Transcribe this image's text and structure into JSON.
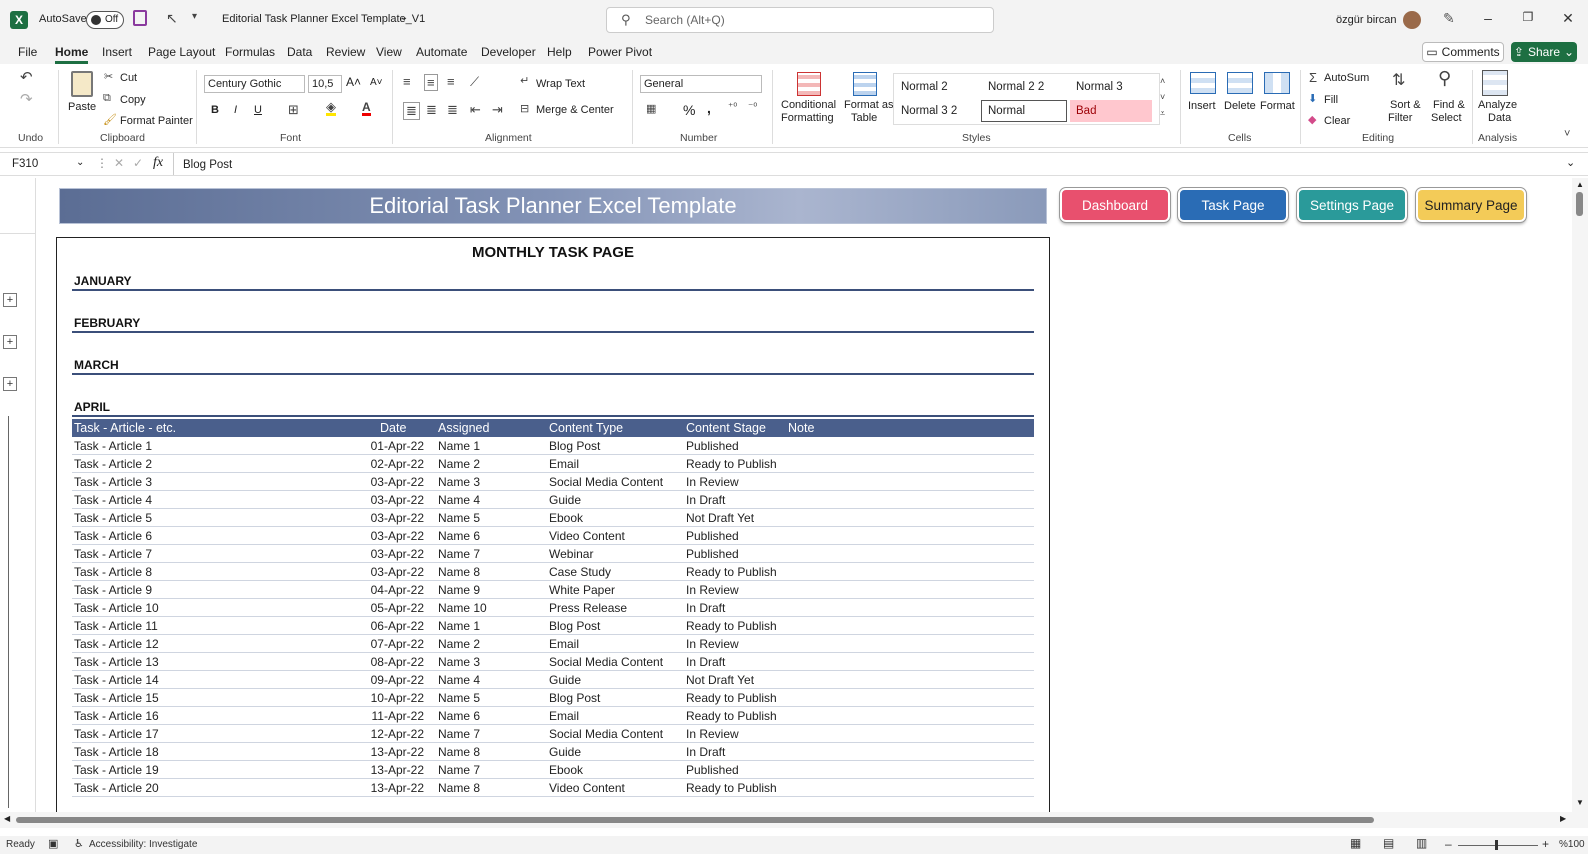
{
  "titlebar": {
    "app_logo": "X",
    "autosave_label": "AutoSave",
    "autosave_state": "Off",
    "doc_title": "Editorial Task Planner Excel Template_V1",
    "search_placeholder": "Search (Alt+Q)",
    "user_name": "özgür bircan"
  },
  "menu": [
    "File",
    "Home",
    "Insert",
    "Page Layout",
    "Formulas",
    "Data",
    "Review",
    "View",
    "Automate",
    "Developer",
    "Help",
    "Power Pivot"
  ],
  "menu_active": "Home",
  "buttons": {
    "comments": "Comments",
    "share": "Share"
  },
  "ribbon": {
    "undo_group": "Undo",
    "clipboard": {
      "paste": "Paste",
      "cut": "Cut",
      "copy": "Copy",
      "format_painter": "Format Painter",
      "label": "Clipboard"
    },
    "font": {
      "name": "Century Gothic",
      "size": "10,5",
      "label": "Font",
      "bold": "B",
      "italic": "I",
      "underline": "U"
    },
    "alignment": {
      "wrap": "Wrap Text",
      "merge": "Merge & Center",
      "label": "Alignment"
    },
    "number": {
      "format": "General",
      "label": "Number",
      "percent": "%",
      "comma": ","
    },
    "styles": {
      "cond1": "Conditional",
      "cond2": "Formatting",
      "fat1": "Format as",
      "fat2": "Table",
      "label": "Styles",
      "cells": [
        "Normal 2",
        "Normal 2 2",
        "Normal 3",
        "Normal 3 2",
        "Normal",
        "Bad"
      ]
    },
    "cells": {
      "insert": "Insert",
      "delete": "Delete",
      "format": "Format",
      "label": "Cells"
    },
    "editing": {
      "autosum": "AutoSum",
      "fill": "Fill",
      "clear": "Clear",
      "sort1": "Sort &",
      "sort2": "Filter",
      "find1": "Find &",
      "find2": "Select",
      "label": "Editing"
    },
    "analysis": {
      "a1": "Analyze",
      "a2": "Data",
      "label": "Analysis"
    }
  },
  "formula_bar": {
    "cell_ref": "F310",
    "fx": "fx",
    "value": "Blog Post"
  },
  "banner": "Editorial Task Planner Excel Template",
  "nav": {
    "dashboard": "Dashboard",
    "task": "Task Page",
    "settings": "Settings Page",
    "summary": "Summary Page"
  },
  "nav_colors": {
    "dashboard": "#e8506e",
    "task": "#2a6cb5",
    "settings": "#2a9a9a",
    "summary": "#f3cb58"
  },
  "panel_title": "MONTHLY TASK PAGE",
  "months": [
    "JANUARY",
    "FEBRUARY",
    "MARCH",
    "APRIL"
  ],
  "table": {
    "headers": [
      "Task - Article - etc.",
      "Date",
      "Assigned",
      "Content Type",
      "Content Stage",
      "Note"
    ],
    "rows": [
      [
        "Task - Article 1",
        "01-Apr-22",
        "Name 1",
        "Blog Post",
        "Published"
      ],
      [
        "Task - Article 2",
        "02-Apr-22",
        "Name 2",
        "Email",
        "Ready to Publish"
      ],
      [
        "Task - Article 3",
        "03-Apr-22",
        "Name 3",
        "Social Media Content",
        "In Review"
      ],
      [
        "Task - Article 4",
        "03-Apr-22",
        "Name 4",
        "Guide",
        "In Draft"
      ],
      [
        "Task - Article 5",
        "03-Apr-22",
        "Name 5",
        "Ebook",
        "Not Draft Yet"
      ],
      [
        "Task - Article 6",
        "03-Apr-22",
        "Name 6",
        "Video Content",
        "Published"
      ],
      [
        "Task - Article 7",
        "03-Apr-22",
        "Name 7",
        "Webinar",
        "Published"
      ],
      [
        "Task - Article 8",
        "03-Apr-22",
        "Name 8",
        "Case Study",
        "Ready to Publish"
      ],
      [
        "Task - Article 9",
        "04-Apr-22",
        "Name 9",
        "White Paper",
        "In Review"
      ],
      [
        "Task - Article 10",
        "05-Apr-22",
        "Name 10",
        "Press Release",
        "In Draft"
      ],
      [
        "Task - Article 11",
        "06-Apr-22",
        "Name 1",
        "Blog Post",
        "Ready to Publish"
      ],
      [
        "Task - Article 12",
        "07-Apr-22",
        "Name 2",
        "Email",
        "In Review"
      ],
      [
        "Task - Article 13",
        "08-Apr-22",
        "Name 3",
        "Social Media Content",
        "In Draft"
      ],
      [
        "Task - Article 14",
        "09-Apr-22",
        "Name 4",
        "Guide",
        "Not Draft Yet"
      ],
      [
        "Task - Article 15",
        "10-Apr-22",
        "Name 5",
        "Blog Post",
        "Ready to Publish"
      ],
      [
        "Task - Article 16",
        "11-Apr-22",
        "Name 6",
        "Email",
        "Ready to Publish"
      ],
      [
        "Task - Article 17",
        "12-Apr-22",
        "Name 7",
        "Social Media Content",
        "In Review"
      ],
      [
        "Task - Article 18",
        "13-Apr-22",
        "Name 8",
        "Guide",
        "In Draft"
      ],
      [
        "Task - Article 19",
        "13-Apr-22",
        "Name 7",
        "Ebook",
        "Published"
      ],
      [
        "Task - Article 20",
        "13-Apr-22",
        "Name 8",
        "Video Content",
        "Ready to Publish"
      ]
    ]
  },
  "status": {
    "ready": "Ready",
    "accessibility": "Accessibility: Investigate",
    "zoom": "%100"
  }
}
